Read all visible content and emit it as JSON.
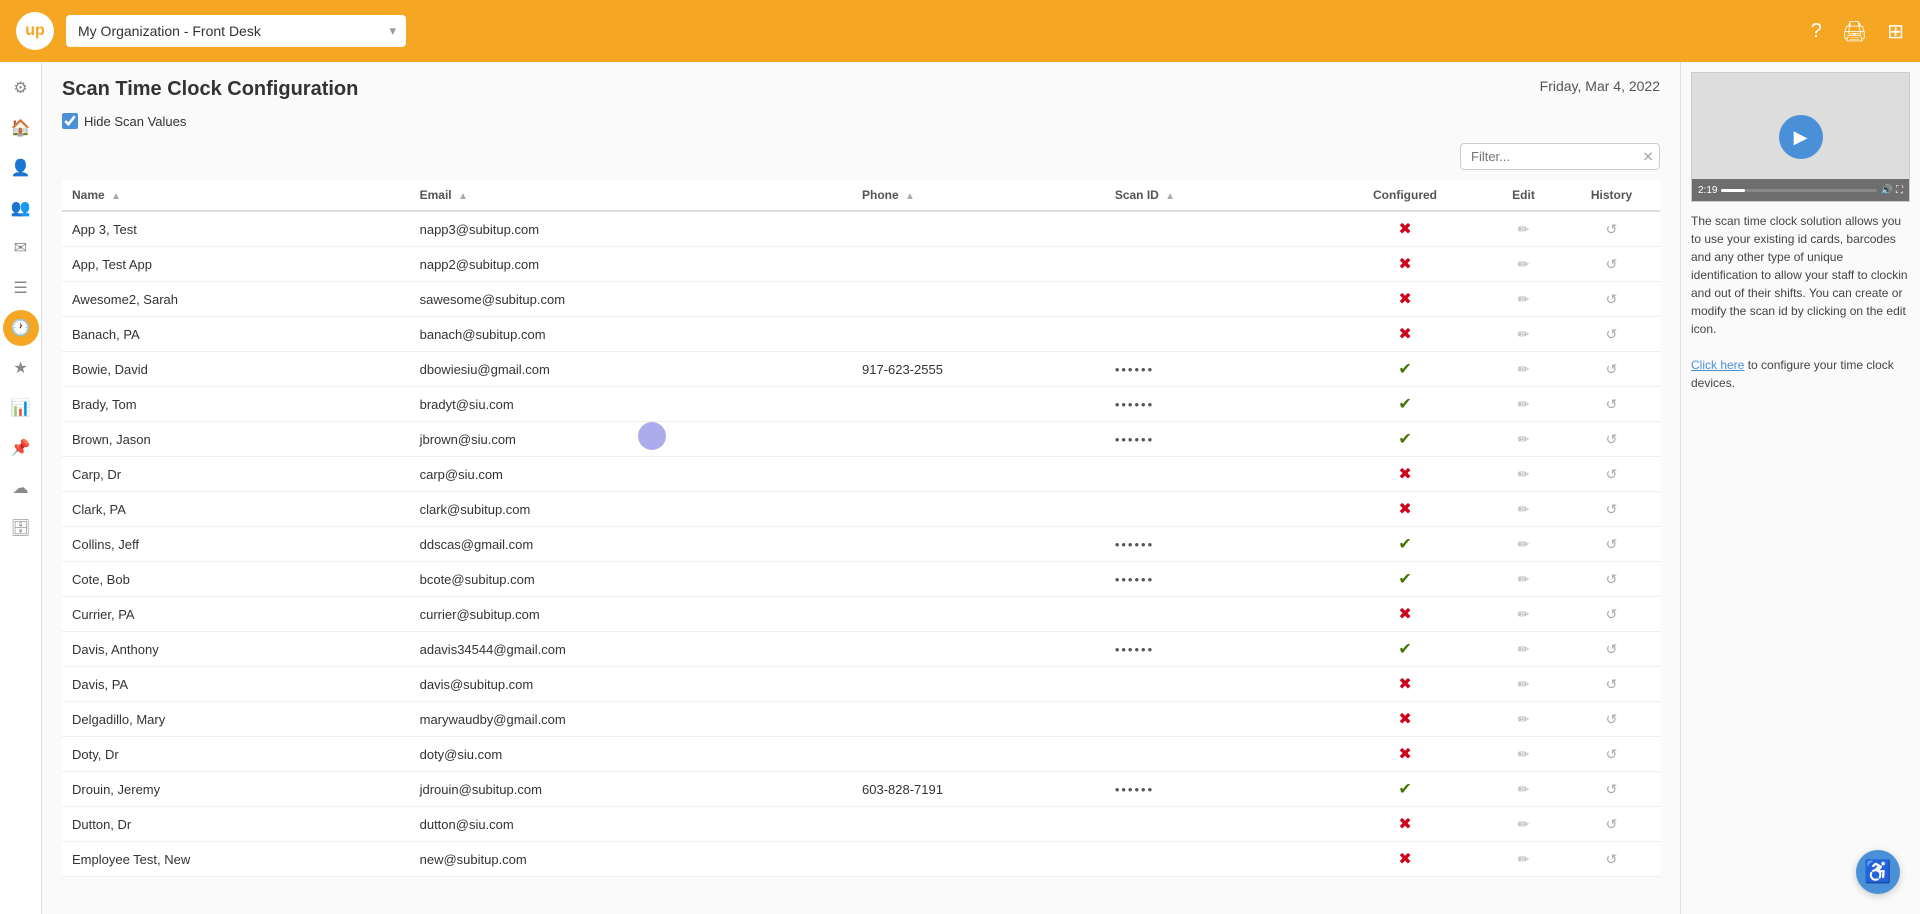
{
  "topbar": {
    "logo": "up",
    "org_selector_value": "My Organization - Front Desk",
    "help_icon": "?",
    "print_icon": "🖨",
    "grid_icon": "⊞"
  },
  "sidebar": {
    "items": [
      {
        "id": "settings",
        "icon": "⚙",
        "active": false
      },
      {
        "id": "home",
        "icon": "🏠",
        "active": false
      },
      {
        "id": "users",
        "icon": "👤",
        "active": false
      },
      {
        "id": "group",
        "icon": "👥",
        "active": false
      },
      {
        "id": "envelope",
        "icon": "✉",
        "active": false
      },
      {
        "id": "list",
        "icon": "☰",
        "active": false
      },
      {
        "id": "clock",
        "icon": "🕐",
        "active": true
      },
      {
        "id": "star",
        "icon": "★",
        "active": false
      },
      {
        "id": "chart",
        "icon": "📊",
        "active": false
      },
      {
        "id": "pin",
        "icon": "📌",
        "active": false
      },
      {
        "id": "cloud",
        "icon": "☁",
        "active": false
      },
      {
        "id": "archive",
        "icon": "🗄",
        "active": false
      }
    ]
  },
  "page": {
    "title": "Scan Time Clock Configuration",
    "date": "Friday, Mar 4, 2022",
    "hide_scan_label": "Hide Scan Values",
    "hide_scan_checked": true,
    "filter_placeholder": "Filter..."
  },
  "table": {
    "columns": [
      {
        "id": "name",
        "label": "Name",
        "sortable": true
      },
      {
        "id": "email",
        "label": "Email",
        "sortable": true
      },
      {
        "id": "phone",
        "label": "Phone",
        "sortable": true
      },
      {
        "id": "scan_id",
        "label": "Scan ID",
        "sortable": true
      },
      {
        "id": "configured",
        "label": "Configured"
      },
      {
        "id": "edit",
        "label": "Edit"
      },
      {
        "id": "history",
        "label": "History"
      }
    ],
    "rows": [
      {
        "name": "App 3, Test",
        "email": "napp3@subitup.com",
        "phone": "",
        "scan_id": "",
        "configured": false
      },
      {
        "name": "App, Test App",
        "email": "napp2@subitup.com",
        "phone": "",
        "scan_id": "",
        "configured": false
      },
      {
        "name": "Awesome2, Sarah",
        "email": "sawesome@subitup.com",
        "phone": "",
        "scan_id": "",
        "configured": false
      },
      {
        "name": "Banach, PA",
        "email": "banach@subitup.com",
        "phone": "",
        "scan_id": "",
        "configured": false
      },
      {
        "name": "Bowie, David",
        "email": "dbowiesiu@gmail.com",
        "phone": "917-623-2555",
        "scan_id": "••••••",
        "configured": true
      },
      {
        "name": "Brady, Tom",
        "email": "bradyt@siu.com",
        "phone": "",
        "scan_id": "••••••",
        "configured": true
      },
      {
        "name": "Brown, Jason",
        "email": "jbrown@siu.com",
        "phone": "",
        "scan_id": "••••••",
        "configured": true
      },
      {
        "name": "Carp, Dr",
        "email": "carp@siu.com",
        "phone": "",
        "scan_id": "",
        "configured": false
      },
      {
        "name": "Clark, PA",
        "email": "clark@subitup.com",
        "phone": "",
        "scan_id": "",
        "configured": false
      },
      {
        "name": "Collins, Jeff",
        "email": "ddscas@gmail.com",
        "phone": "",
        "scan_id": "••••••",
        "configured": true
      },
      {
        "name": "Cote, Bob",
        "email": "bcote@subitup.com",
        "phone": "",
        "scan_id": "••••••",
        "configured": true
      },
      {
        "name": "Currier, PA",
        "email": "currier@subitup.com",
        "phone": "",
        "scan_id": "",
        "configured": false
      },
      {
        "name": "Davis, Anthony",
        "email": "adavis34544@gmail.com",
        "phone": "",
        "scan_id": "••••••",
        "configured": true
      },
      {
        "name": "Davis, PA",
        "email": "davis@subitup.com",
        "phone": "",
        "scan_id": "",
        "configured": false
      },
      {
        "name": "Delgadillo, Mary",
        "email": "marywaudby@gmail.com",
        "phone": "",
        "scan_id": "",
        "configured": false
      },
      {
        "name": "Doty, Dr",
        "email": "doty@siu.com",
        "phone": "",
        "scan_id": "",
        "configured": false
      },
      {
        "name": "Drouin, Jeremy",
        "email": "jdrouin@subitup.com",
        "phone": "603-828-7191",
        "scan_id": "••••••",
        "configured": true
      },
      {
        "name": "Dutton, Dr",
        "email": "dutton@siu.com",
        "phone": "",
        "scan_id": "",
        "configured": false
      },
      {
        "name": "Employee Test, New",
        "email": "new@subitup.com",
        "phone": "",
        "scan_id": "",
        "configured": false
      }
    ]
  },
  "right_panel": {
    "video_time": "2:19",
    "description": "The scan time clock solution allows you to use your existing id cards, barcodes and any other type of unique identification to allow your staff to clockin and out of their shifts. You can create or modify the scan id by clicking on the edit icon.",
    "link_text": "Click here",
    "link_suffix": " to configure your time clock devices."
  },
  "accessibility": {
    "icon": "♿"
  }
}
